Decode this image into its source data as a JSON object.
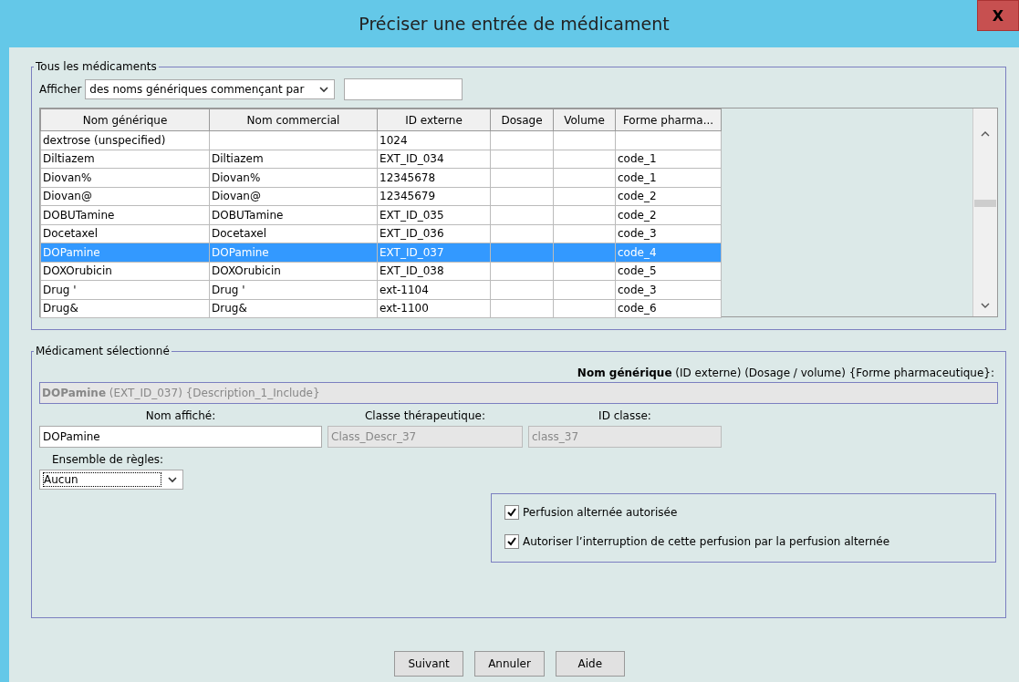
{
  "window": {
    "title": "Préciser une entrée de médicament",
    "close": "X"
  },
  "all_medications": {
    "legend": "Tous les médicaments",
    "filter_label": "Afficher",
    "filter_dropdown": "des noms génériques commençant par"
  },
  "table": {
    "columns": [
      "Nom générique",
      "Nom commercial",
      "ID externe",
      "Dosage",
      "Volume",
      "Forme pharma..."
    ],
    "rows": [
      {
        "cells": [
          "dextrose (unspecified)",
          null,
          "1024",
          null,
          null,
          null
        ],
        "selected": false
      },
      {
        "cells": [
          "Diltiazem",
          "Diltiazem",
          "EXT_ID_034",
          null,
          null,
          "code_1"
        ],
        "selected": false
      },
      {
        "cells": [
          "Diovan%",
          "Diovan%",
          "12345678",
          null,
          null,
          "code_1"
        ],
        "selected": false
      },
      {
        "cells": [
          "Diovan@",
          "Diovan@",
          "12345679",
          null,
          null,
          "code_2"
        ],
        "selected": false
      },
      {
        "cells": [
          "DOBUTamine",
          "DOBUTamine",
          "EXT_ID_035",
          null,
          null,
          "code_2"
        ],
        "selected": false
      },
      {
        "cells": [
          "Docetaxel",
          "Docetaxel",
          "EXT_ID_036",
          null,
          null,
          "code_3"
        ],
        "selected": false
      },
      {
        "cells": [
          "DOPamine",
          "DOPamine",
          "EXT_ID_037",
          null,
          null,
          "code_4"
        ],
        "selected": true
      },
      {
        "cells": [
          "DOXOrubicin",
          "DOXOrubicin",
          "EXT_ID_038",
          null,
          null,
          "code_5"
        ],
        "selected": false
      },
      {
        "cells": [
          "Drug '",
          "Drug '",
          "ext-1104",
          null,
          null,
          "code_3"
        ],
        "selected": false
      },
      {
        "cells": [
          "Drug&",
          "Drug&",
          "ext-1100",
          null,
          null,
          "code_6"
        ],
        "selected": false
      }
    ]
  },
  "selected_medication": {
    "legend": "Médicament sélectionné",
    "summary_label": "**Nom générique** (ID externe) (Dosage / volume) {Forme pharmaceutique}:",
    "summary_value": "**DOPamine** (EXT_ID_037) {Description_1_Include}",
    "fields": [
      {
        "label": "Nom affiché:",
        "value": "DOPamine",
        "disabled": false
      },
      {
        "label": "Classe thérapeutique:",
        "value": "Class_Descr_37",
        "disabled": true
      },
      {
        "label": "ID classe:",
        "value": "class_37",
        "disabled": true
      }
    ],
    "rule_set": {
      "label": "Ensemble de règles:",
      "value": "Aucun"
    },
    "options": [
      {
        "label": "Perfusion alternée autorisée",
        "checked": true
      },
      {
        "label": "Autoriser l’interruption de cette perfusion par la perfusion alternée",
        "checked": true
      }
    ]
  },
  "buttons": [
    "Suivant",
    "Annuler",
    "Aide"
  ]
}
